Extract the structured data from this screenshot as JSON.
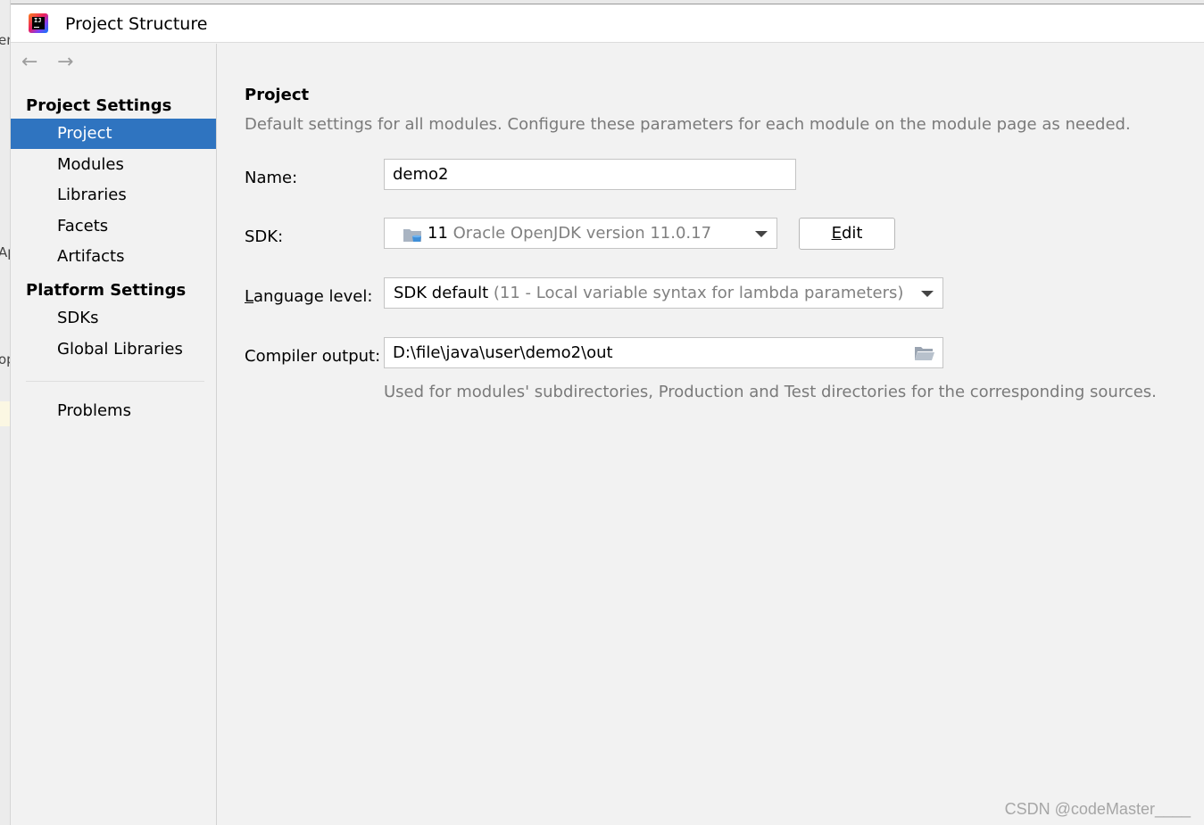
{
  "window": {
    "title": "Project Structure"
  },
  "backdrop": {
    "frag1": "en",
    "frag2": "Ap",
    "frag3": "op"
  },
  "sidebar": {
    "back_glyph": "←",
    "forward_glyph": "→",
    "project_settings_header": "Project Settings",
    "project_items": [
      "Project",
      "Modules",
      "Libraries",
      "Facets",
      "Artifacts"
    ],
    "platform_settings_header": "Platform Settings",
    "platform_items": [
      "SDKs",
      "Global Libraries"
    ],
    "problems": "Problems",
    "selected": "Project"
  },
  "content": {
    "title": "Project",
    "description": "Default settings for all modules. Configure these parameters for each module on the module page as needed.",
    "name": {
      "label": "Name:",
      "value": "demo2"
    },
    "sdk": {
      "label": "SDK:",
      "version": "11",
      "detail": "Oracle OpenJDK version 11.0.17",
      "edit_button": {
        "mnemonic": "E",
        "rest": "dit"
      }
    },
    "language_level": {
      "label_mnemonic": "L",
      "label_rest": "anguage level:",
      "value_main": "SDK default",
      "value_detail": "(11 - Local variable syntax for lambda parameters)"
    },
    "compiler_output": {
      "label": "Compiler output:",
      "value": "D:\\file\\java\\user\\demo2\\out",
      "hint": "Used for modules' subdirectories, Production and Test directories for the corresponding sources."
    }
  },
  "watermark": "CSDN @codeMaster____",
  "colors": {
    "selection": "#2f74c0",
    "background": "#f2f2f2",
    "muted_text": "#7a7a7a"
  }
}
